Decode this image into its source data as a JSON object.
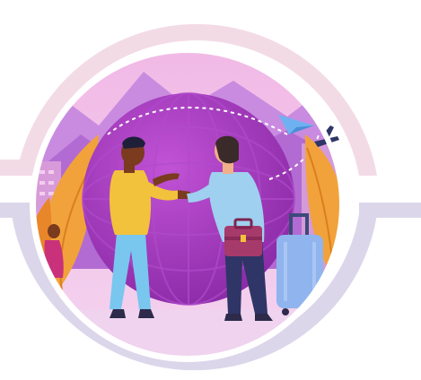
{
  "illustration": {
    "subject": "two-travelers-handshake-globe",
    "icons": [
      "globe-icon",
      "paper-plane-icon",
      "airplane-icon",
      "briefcase-icon",
      "suitcase-icon"
    ]
  },
  "colors": {
    "pink_ring": "#f3dbe6",
    "lavender_ring": "#dcd6ea",
    "globe": "#9b35b8",
    "sky": "#e9a0d3",
    "mountain": "#c07fd9",
    "leaf_orange": "#f2a23a",
    "man_left_shirt": "#f2c23c",
    "man_right_shirt": "#9fd0ef",
    "suitcase": "#8fb4ee",
    "briefcase": "#a63a6b"
  }
}
